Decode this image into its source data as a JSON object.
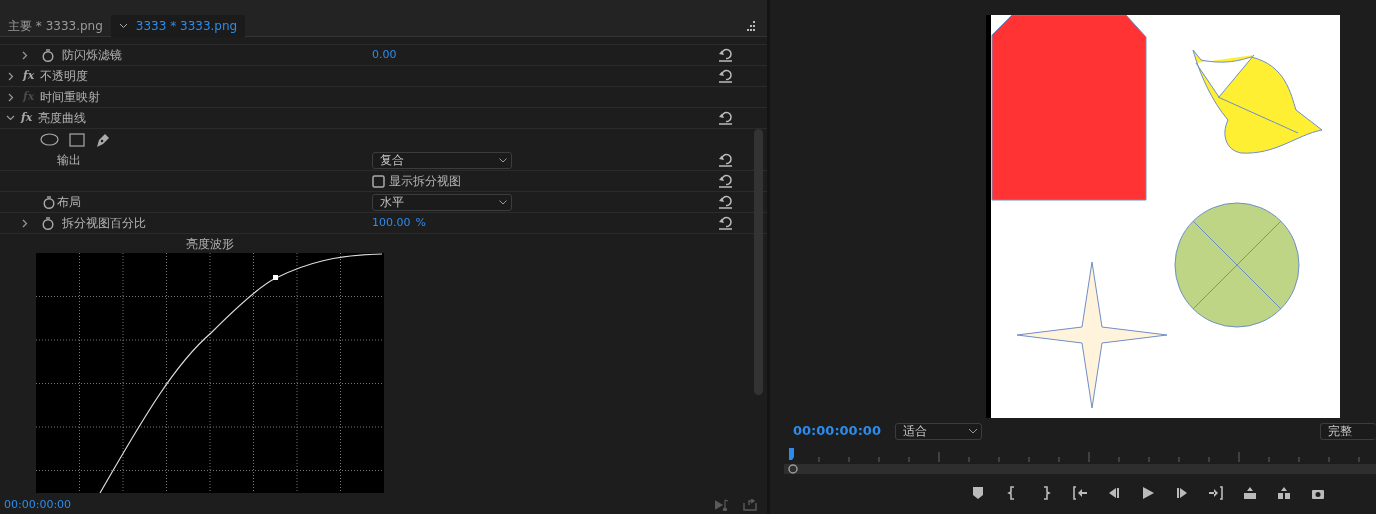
{
  "tabs": [
    {
      "label": "主要 * 3333.png",
      "selected": false
    },
    {
      "label": "3333 * 3333.png",
      "selected": true
    }
  ],
  "effect_rows": [
    {
      "kind": "property",
      "label": "防闪烁滤镜",
      "value": "0.00",
      "expandable": true,
      "stopwatch": true,
      "reset": true
    },
    {
      "kind": "effect",
      "fx": "fx",
      "label": "不透明度",
      "expanded": false,
      "enabled": true,
      "reset": true
    },
    {
      "kind": "effect",
      "fx": "fx",
      "label": "时间重映射",
      "expanded": false,
      "enabled": false,
      "reset": false
    },
    {
      "kind": "effect",
      "fx": "fx",
      "label": "亮度曲线",
      "expanded": true,
      "enabled": true,
      "reset": true
    },
    {
      "kind": "mask_tools",
      "reset": false
    },
    {
      "kind": "dropdown",
      "label": "输出",
      "value": "复合",
      "stopwatch": false,
      "reset": true
    },
    {
      "kind": "checkbox",
      "label": "显示拆分视图",
      "checked": false,
      "reset": true
    },
    {
      "kind": "dropdown",
      "label": "布局",
      "value": "水平",
      "stopwatch": true,
      "reset": true
    },
    {
      "kind": "property",
      "label": "拆分视图百分比",
      "value": "100.00",
      "unit": "%",
      "expandable": true,
      "stopwatch": true,
      "reset": true
    }
  ],
  "waveform": {
    "title": "亮度波形"
  },
  "effects_timecode": "00:00:00:00",
  "monitor": {
    "timecode": "00:00:00:00",
    "zoom": "适合",
    "resolution": "完整"
  }
}
